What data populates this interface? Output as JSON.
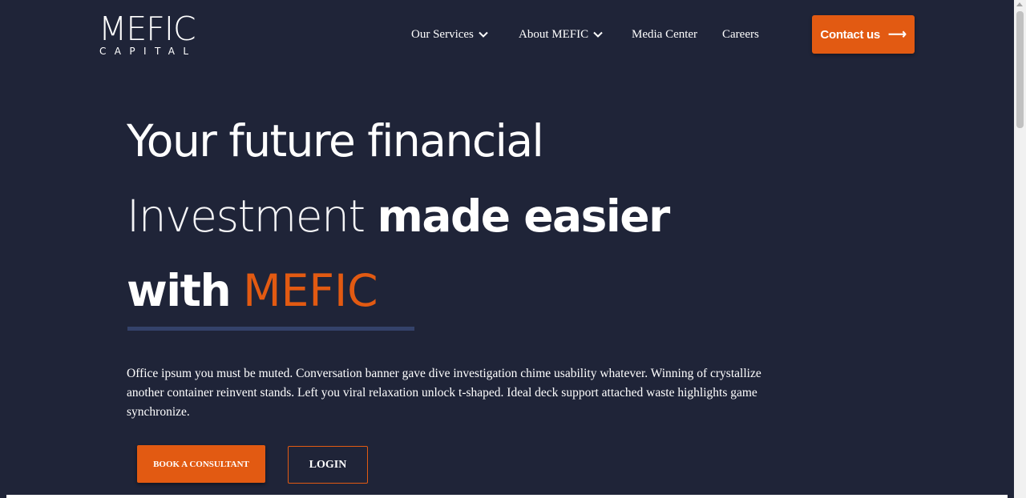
{
  "brand": {
    "logo_main": "MEFIC",
    "logo_sub": "CAPITAL"
  },
  "nav": {
    "items": [
      {
        "label": "Our Services",
        "has_dropdown": true
      },
      {
        "label": "About MEFIC",
        "has_dropdown": true
      },
      {
        "label": "Media Center",
        "has_dropdown": false
      },
      {
        "label": "Careers",
        "has_dropdown": false
      }
    ],
    "contact_label": "Contact us",
    "contact_icon": "arrow-right-icon"
  },
  "hero": {
    "line1": "Your future financial",
    "line2_thin": "Investment",
    "line2_bold": "made easier",
    "line3_prefix": "with",
    "line3_accent": "MEFIC",
    "description": "Office ipsum you must be muted. Conversation banner gave dive investigation chime usability whatever. Winning of crystallize another container reinvent stands. Left you viral relaxation unlock t-shaped. Ideal deck support attached waste highlights game synchronize.",
    "book_label": "BOOK A CONSULTANT",
    "login_label": "LOGIN"
  },
  "colors": {
    "background": "#1f2438",
    "accent": "#e25a12",
    "underline": "#34426a",
    "text": "#ffffff"
  }
}
